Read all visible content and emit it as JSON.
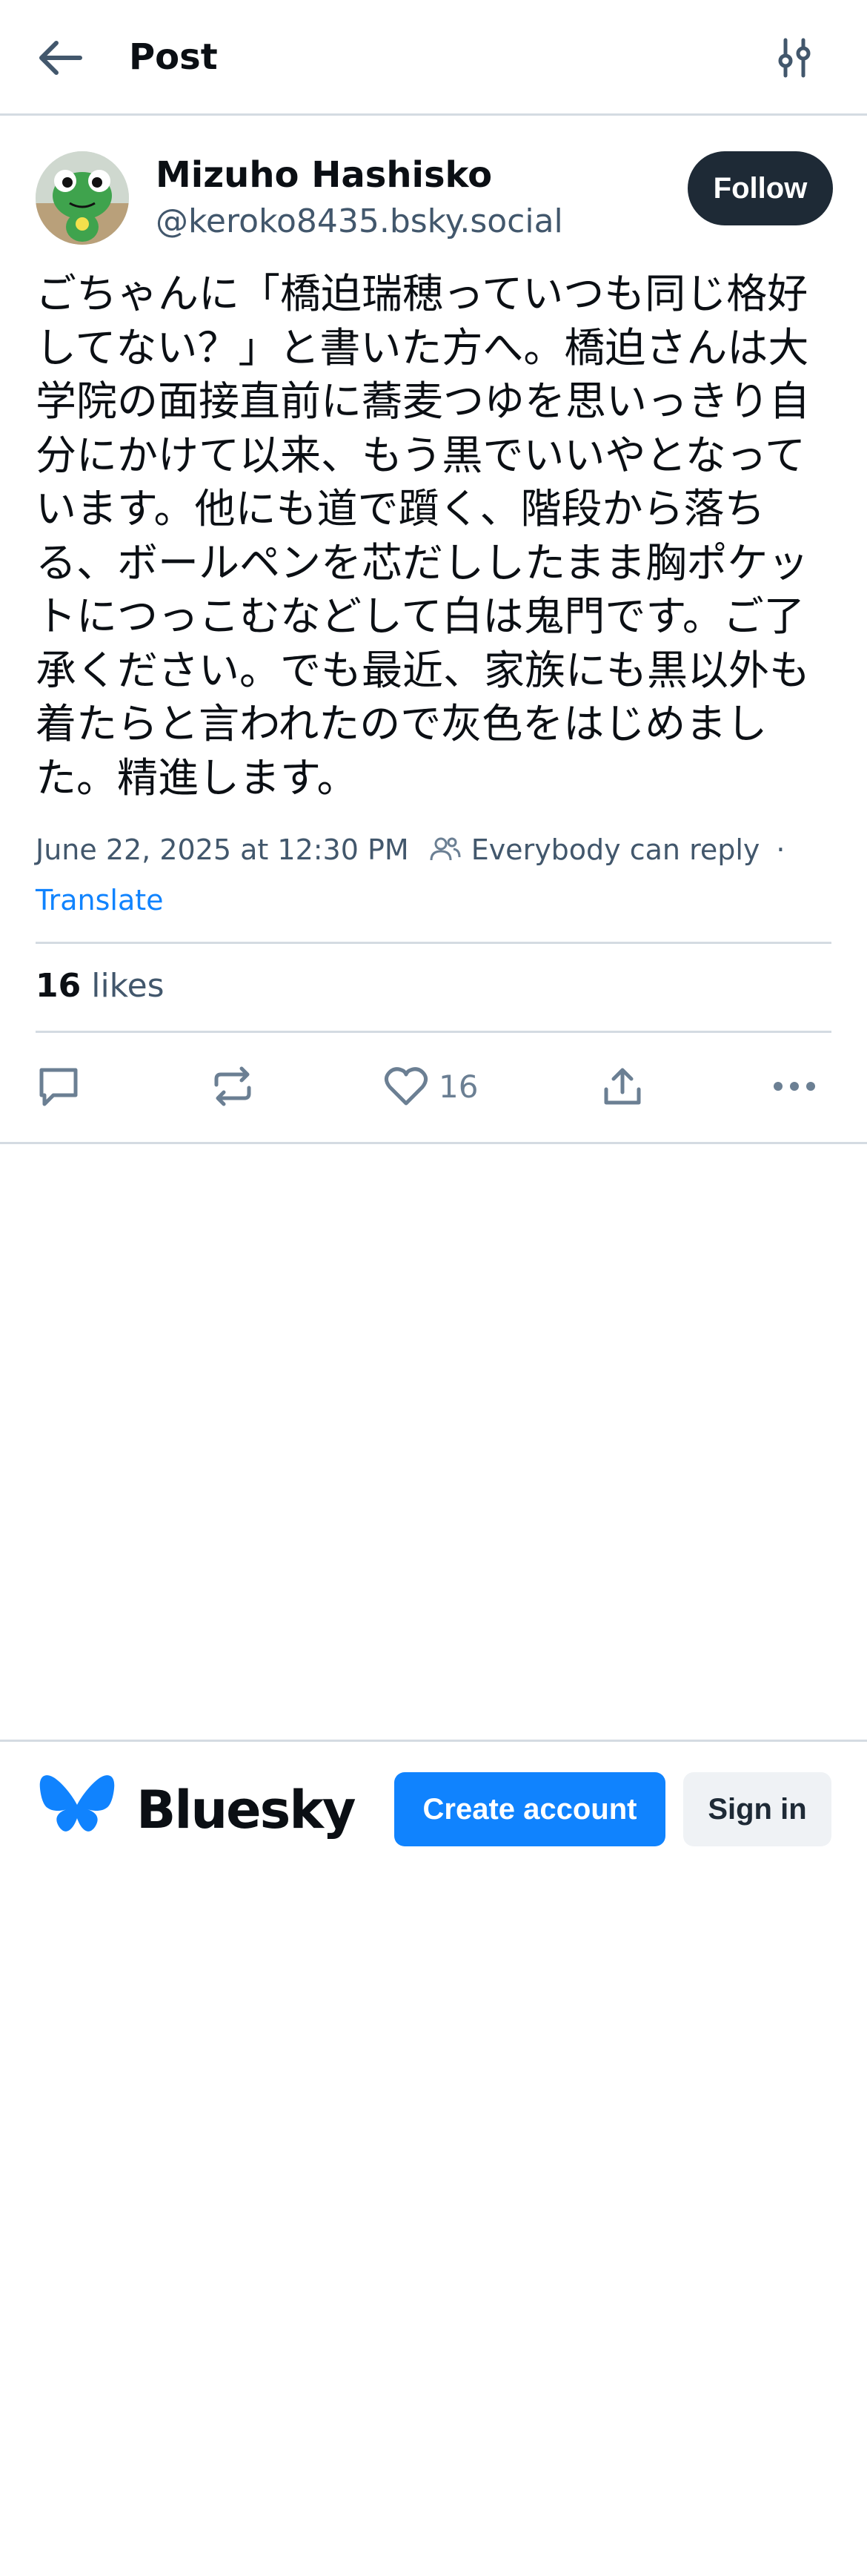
{
  "header": {
    "title": "Post"
  },
  "post": {
    "author": {
      "display_name": "Mizuho Hashisko",
      "handle": "@keroko8435.bsky.social"
    },
    "follow_label": "Follow",
    "text": "ごちゃんに「橋迫瑞穂っていつも同じ格好してない？」と書いた方へ。橋迫さんは大学院の面接直前に蕎麦つゆを思いっきり自分にかけて以来、もう黒でいいやとなっています。他にも道で躓く、階段から落ちる、ボールペンを芯だししたまま胸ポケットにつっこむなどして白は鬼門です。ご了承ください。でも最近、家族にも黒以外も着たらと言われたので灰色をはじめました。精進します。",
    "timestamp": "June 22, 2025 at 12:30 PM",
    "reply_setting": "Everybody can reply",
    "separator": "·",
    "translate_label": "Translate",
    "likes": {
      "count": "16",
      "label": "likes"
    },
    "actions": {
      "like_count": "16"
    }
  },
  "footer": {
    "brand": "Bluesky",
    "create_account": "Create account",
    "sign_in": "Sign in"
  },
  "colors": {
    "accent": "#1083fe",
    "dark_button": "#1e2a36",
    "muted_text": "#42576c",
    "divider": "#d4dbe2"
  },
  "icons": [
    "arrow-left-icon",
    "sliders-icon",
    "people-icon",
    "reply-icon",
    "repost-icon",
    "heart-icon",
    "share-icon",
    "more-icon",
    "butterfly-logo"
  ]
}
